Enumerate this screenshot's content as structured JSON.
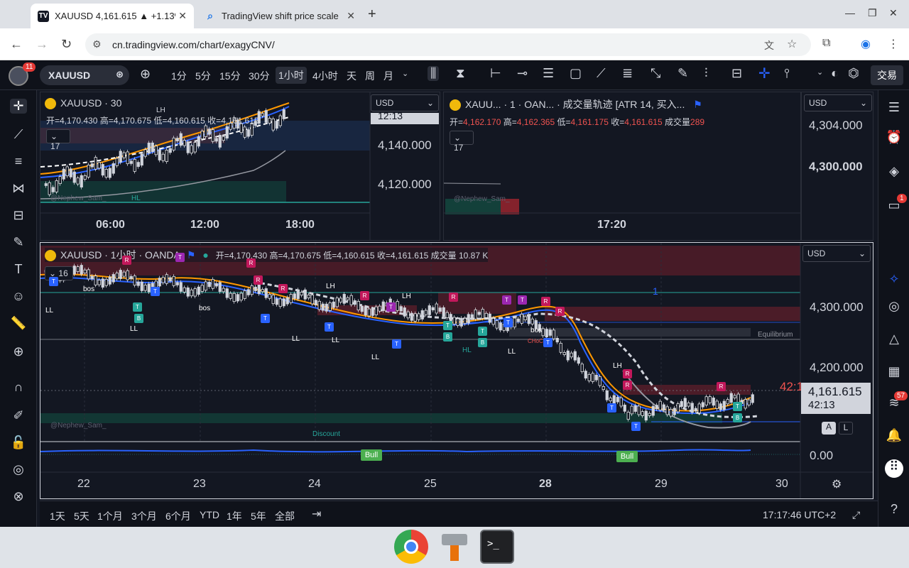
{
  "browser": {
    "tabs": [
      {
        "title": "XAUUSD 4,161.615 ▲ +1.13%",
        "active": true,
        "favicon": "tradingview-icon"
      },
      {
        "title": "TradingView shift price scale",
        "active": false,
        "favicon": "google-icon"
      }
    ],
    "url": "cn.tradingview.com/chart/exagyCNV/"
  },
  "toolbar": {
    "avatar_badge": "11",
    "symbol": "XAUUSD",
    "intervals": [
      "1分",
      "5分",
      "15分",
      "30分",
      "1小时",
      "4小时",
      "天",
      "周",
      "月"
    ],
    "selected_interval": "1小时",
    "trade_label": "交易"
  },
  "pane1": {
    "title": "XAUUSD · 30",
    "ohlc": "开=4,170.430 高=4,170.675 低=4,160.615 收=4,161.615",
    "indicators_count": "17",
    "currency": "USD",
    "price_ticks": [
      "12:13",
      "4,140.000",
      "4,120.000"
    ],
    "time_ticks": [
      "06:00",
      "12:00",
      "18:00"
    ],
    "watermark": "@Nephew_Sam_",
    "labels": [
      "LH",
      "HL"
    ]
  },
  "pane2": {
    "title": "XAUU... · 1 · OAN... · 成交量轨迹 [ATR 14, 买入...",
    "ohlc": {
      "open_label": "开=",
      "open": "4,162.170",
      "high_label": "高=",
      "high": "4,162.365",
      "low_label": "低=",
      "low": "4,161.175",
      "close_label": "收=",
      "close": "4,161.615",
      "vol_label": "成交量",
      "vol": "289"
    },
    "indicators_count": "17",
    "time_tick": "17:20",
    "watermark": "@Nephew_Sam_"
  },
  "pane3": {
    "currency": "USD",
    "price_ticks": [
      "4,304.000",
      "4,300.000"
    ]
  },
  "main": {
    "title": "XAUUSD · 1小时 · OANDA",
    "ohlc": "开=4,170.430 高=4,170.675 低=4,160.615 收=4,161.615 成交量 10.87 K",
    "indicators_count": "16",
    "currency": "USD",
    "price_ticks": [
      "4,300.000",
      "4,200.000"
    ],
    "current_price": "4,161.615",
    "countdown": "42:13",
    "countdown_partial": "42:1",
    "osc_value": "0.00",
    "time_ticks": [
      "22",
      "23",
      "24",
      "25",
      "28",
      "29",
      "30"
    ],
    "auto_label": "A",
    "log_label": "L",
    "labels": {
      "equilibrium": "Equilibrium",
      "discount": "Discount",
      "watermark": "@Nephew_Sam_",
      "bull1": "Bull",
      "bull2": "Bull",
      "bos": "bos",
      "choch": "CHoCH",
      "ll": "LL",
      "lh": "LH",
      "hl": "HL",
      "one": "1"
    }
  },
  "bottom": {
    "ranges": [
      "1天",
      "5天",
      "1个月",
      "3个月",
      "6个月",
      "YTD",
      "1年",
      "5年",
      "全部"
    ],
    "clock": "17:17:46 UTC+2"
  },
  "right_badges": {
    "chat": "1",
    "feed": "57"
  },
  "colors": {
    "bull": "#26a69a",
    "bear": "#ef5350",
    "bg": "#131722",
    "accent": "#2962ff",
    "orange": "#ff9800",
    "blue": "#2962ff",
    "gray": "#9598a1"
  }
}
